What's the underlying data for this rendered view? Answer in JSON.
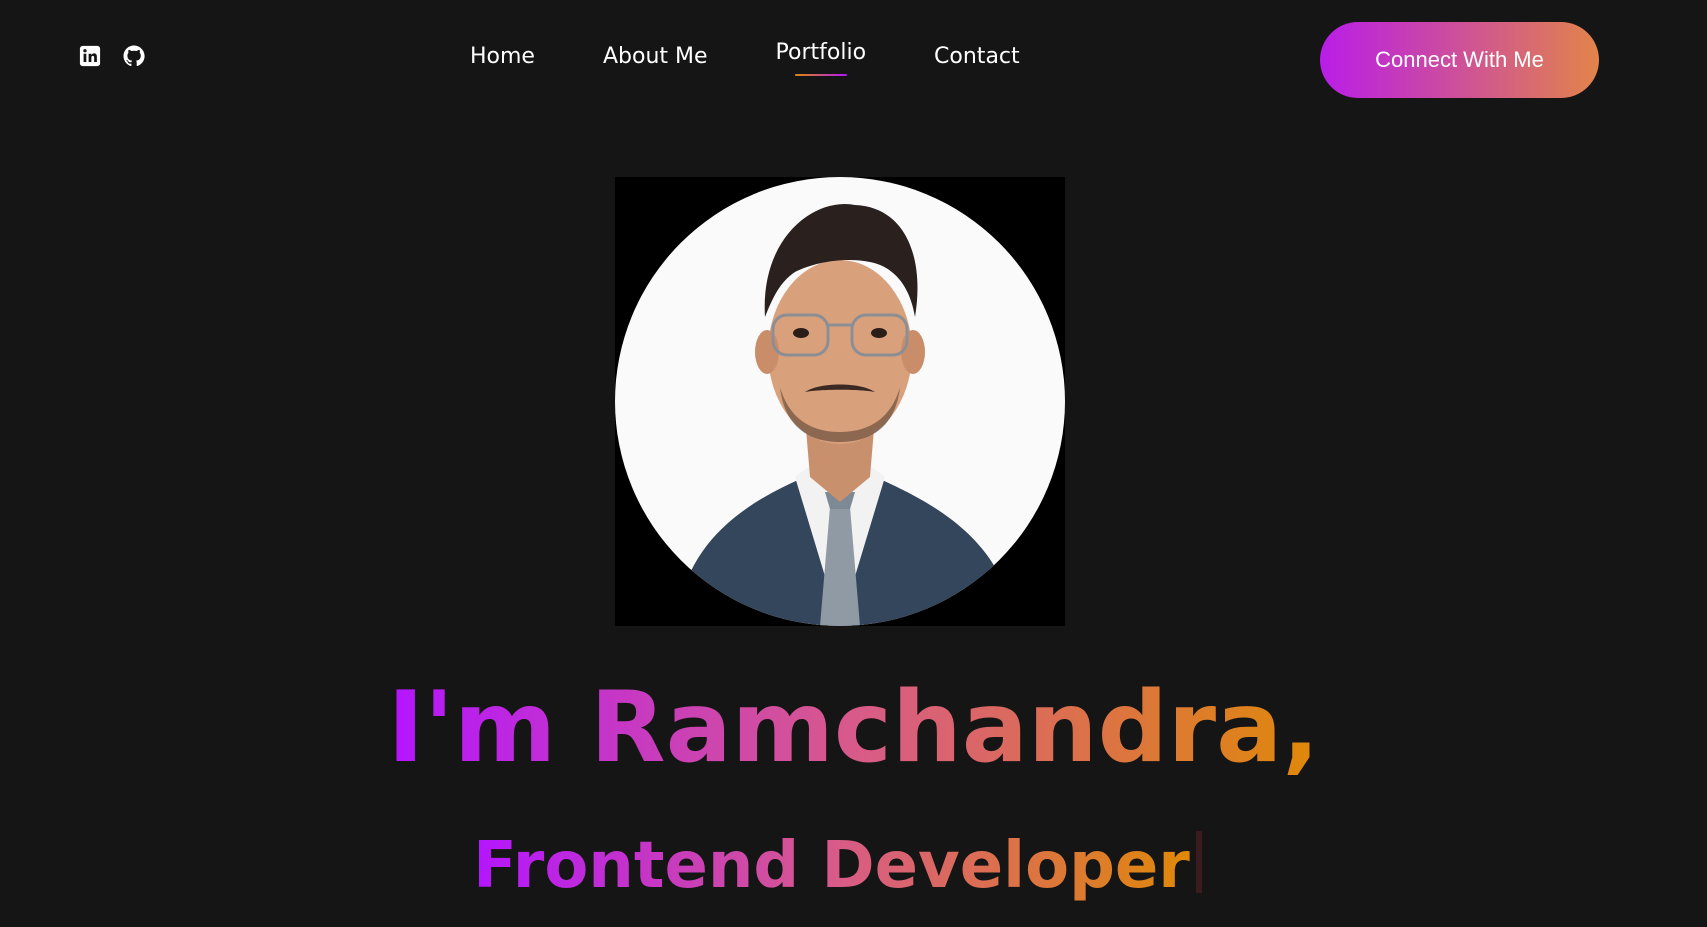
{
  "nav": {
    "social": [
      {
        "icon": "linkedin-icon"
      },
      {
        "icon": "github-icon"
      }
    ],
    "links": [
      {
        "label": "Home"
      },
      {
        "label": "About Me"
      },
      {
        "label": "Portfolio",
        "active": true
      },
      {
        "label": "Contact"
      }
    ],
    "cta_label": "Connect With Me"
  },
  "hero": {
    "photo_alt": "profile-photo",
    "title": "I'm Ramchandra,",
    "role": "Frontend Developer"
  },
  "colors": {
    "background": "#161515",
    "gradient_start": "#b415ff",
    "gradient_end": "#df8908",
    "text": "#ffffff"
  }
}
